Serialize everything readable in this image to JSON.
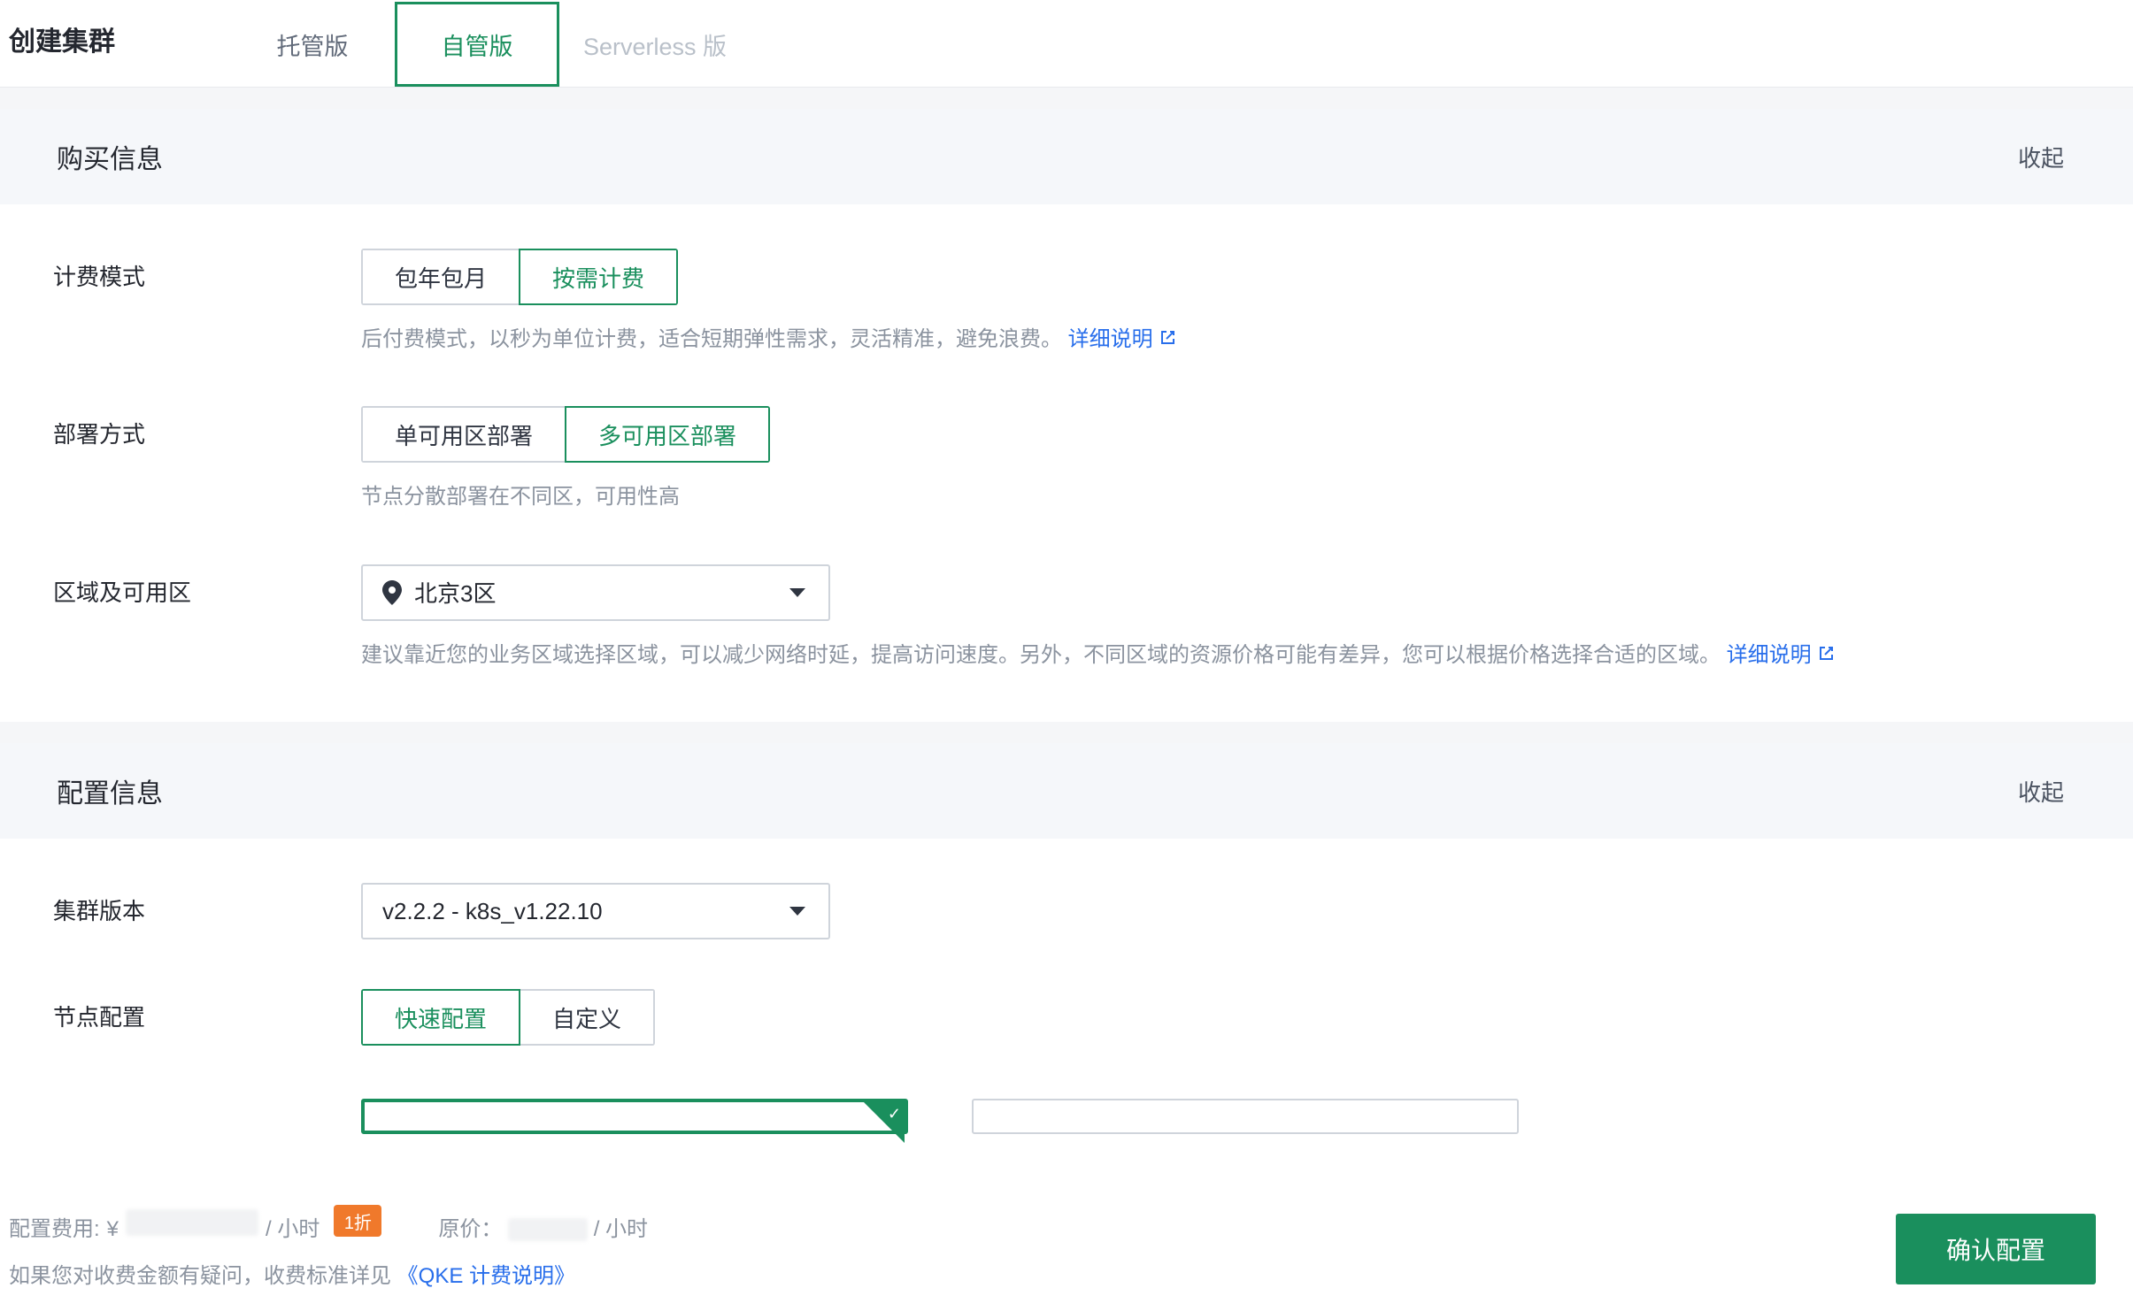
{
  "header": {
    "title": "创建集群",
    "tabs": [
      {
        "label": "托管版",
        "active": false,
        "disabled": false
      },
      {
        "label": "自管版",
        "active": true,
        "disabled": false
      },
      {
        "label": "Serverless 版",
        "active": false,
        "disabled": true
      }
    ]
  },
  "sections": {
    "purchase": {
      "title": "购买信息",
      "collapse": "收起",
      "billing": {
        "label": "计费模式",
        "options": [
          "包年包月",
          "按需计费"
        ],
        "activeIndex": 1,
        "helper": "后付费模式，以秒为单位计费，适合短期弹性需求，灵活精准，避免浪费。",
        "helperLink": "详细说明"
      },
      "deploy": {
        "label": "部署方式",
        "options": [
          "单可用区部署",
          "多可用区部署"
        ],
        "activeIndex": 1,
        "helper": "节点分散部署在不同区，可用性高"
      },
      "region": {
        "label": "区域及可用区",
        "value": "北京3区",
        "helper": "建议靠近您的业务区域选择区域，可以减少网络时延，提高访问速度。另外，不同区域的资源价格可能有差异，您可以根据价格选择合适的区域。",
        "helperLink": "详细说明"
      }
    },
    "config": {
      "title": "配置信息",
      "collapse": "收起",
      "version": {
        "label": "集群版本",
        "value": "v2.2.2 - k8s_v1.22.10"
      },
      "node": {
        "label": "节点配置",
        "options": [
          "快速配置",
          "自定义"
        ],
        "activeIndex": 0
      }
    }
  },
  "footer": {
    "costLabel": "配置费用:",
    "currency": "¥",
    "unit": "/ 小时",
    "discount": "1折",
    "origLabel": "原价：",
    "origUnit": "/ 小时",
    "helpPrefix": "如果您对收费金额有疑问，收费标准详见",
    "docLink": "《QKE 计费说明》",
    "confirm": "确认配置"
  }
}
